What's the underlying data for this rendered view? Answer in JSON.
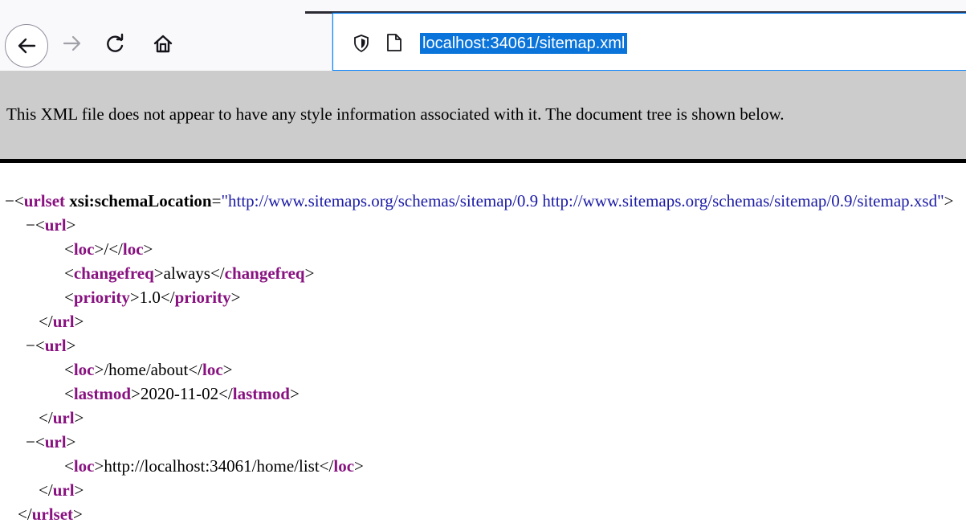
{
  "browser": {
    "url": "localhost:34061/sitemap.xml",
    "icons": [
      "back-arrow-icon",
      "forward-arrow-icon",
      "reload-icon",
      "home-icon",
      "shield-icon",
      "page-icon"
    ],
    "colors": {
      "accent": "#0a84ff",
      "selection": "#0a74da"
    }
  },
  "notice": {
    "text": "This XML file does not appear to have any style information associated with it. The document tree is shown below."
  },
  "xml": {
    "collapse_marker": "−",
    "urlset_tag": "urlset",
    "schema_attr": "xsi:schemaLocation",
    "schema_value": "\"http://www.sitemaps.org/schemas/sitemap/0.9 http://www.sitemaps.org/schemas/sitemap/0.9/sitemap.xsd\"",
    "url_tag": "url",
    "urls": [
      {
        "children": [
          {
            "tag": "loc",
            "value": "/"
          },
          {
            "tag": "changefreq",
            "value": "always"
          },
          {
            "tag": "priority",
            "value": "1.0"
          }
        ]
      },
      {
        "children": [
          {
            "tag": "loc",
            "value": "/home/about"
          },
          {
            "tag": "lastmod",
            "value": "2020-11-02"
          }
        ]
      },
      {
        "children": [
          {
            "tag": "loc",
            "value": "http://localhost:34061/home/list"
          }
        ]
      }
    ],
    "colors": {
      "tag": "#881280",
      "attribute_value": "#1a1aa6"
    }
  }
}
